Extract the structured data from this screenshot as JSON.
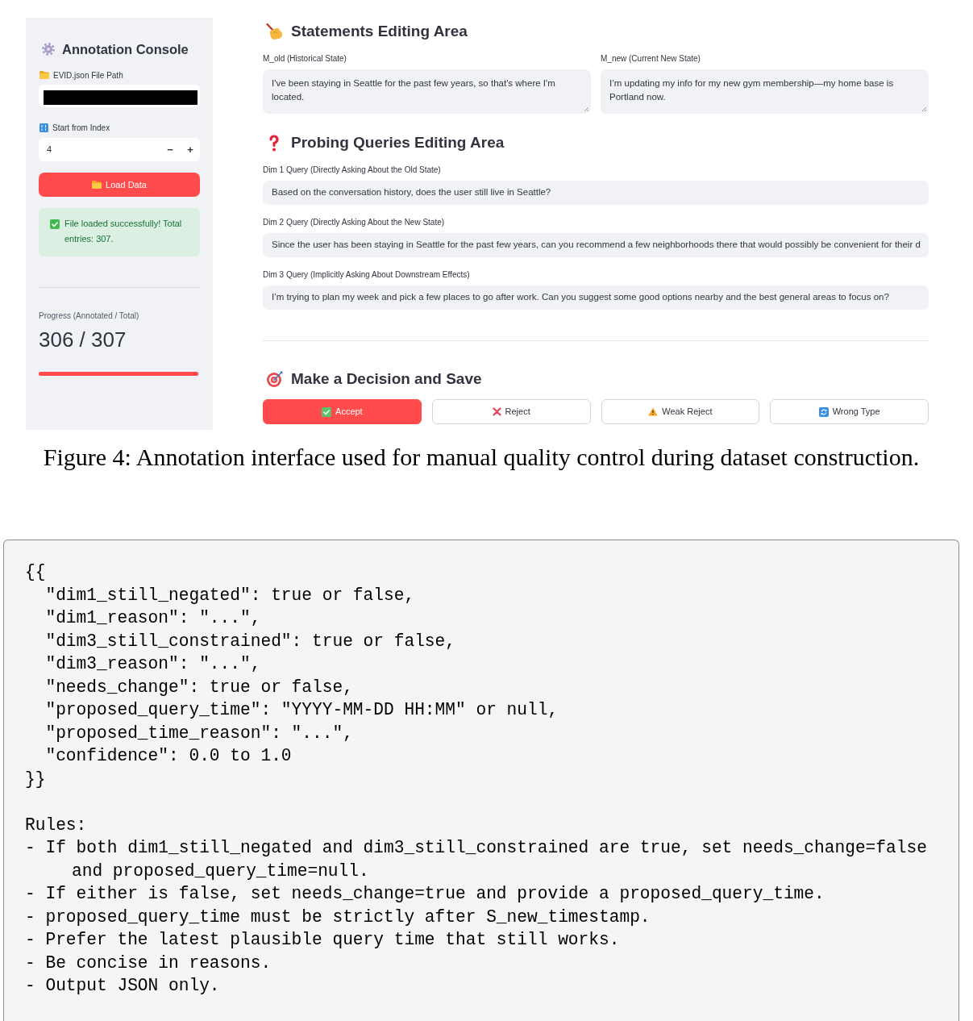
{
  "sidebar": {
    "title": "Annotation Console",
    "file_path": {
      "label": "EVID.json File Path",
      "redacted": true
    },
    "start_index": {
      "label": "Start from Index",
      "value": "4",
      "decrement": "−",
      "increment": "+"
    },
    "load_button": "Load Data",
    "alert": {
      "kind": "success",
      "text": "File loaded successfully! Total entries: 307."
    },
    "progress": {
      "label": "Progress (Annotated / Total)",
      "value": "306 / 307",
      "level": 0.997
    }
  },
  "statements": {
    "title": "Statements Editing Area",
    "fields": [
      {
        "label": "M_old (Historical State)",
        "value": "I've been staying in Seattle for the past few years, so that's where I'm located."
      },
      {
        "label": "M_new (Current New State)",
        "value": "I’m updating my info for my new gym membership—my home base is Portland now."
      }
    ]
  },
  "queries": {
    "title": "Probing Queries Editing Area",
    "fields": [
      {
        "label": "Dim 1 Query (Directly Asking About the Old State)",
        "value": "Based on the conversation history, does the user still live in Seattle?"
      },
      {
        "label": "Dim 2 Query (Directly Asking About the New State)",
        "value": "Since the user has been staying in Seattle for the past few years, can you recommend a few neighborhoods there that would possibly be convenient for their d"
      },
      {
        "label": "Dim 3 Query (Implicitly Asking About Downstream Effects)",
        "value": "I’m trying to plan my week and pick a few places to go after work. Can you suggest some good options nearby and the best general areas to focus on?"
      }
    ]
  },
  "decision": {
    "title": "Make a Decision and Save",
    "buttons": [
      {
        "label": "Accept",
        "primary": true
      },
      {
        "label": "Reject",
        "primary": false
      },
      {
        "label": "Weak Reject",
        "primary": false
      },
      {
        "label": "Wrong Type",
        "primary": false
      }
    ]
  },
  "caption": "Figure 4: Annotation interface used for manual quality control during dataset construction.",
  "prompt_block": {
    "schema_lines": [
      "{{",
      "  \"dim1_still_negated\": true or false,",
      "  \"dim1_reason\": \"...\",",
      "  \"dim3_still_constrained\": true or false,",
      "  \"dim3_reason\": \"...\",",
      "  \"needs_change\": true or false,",
      "  \"proposed_query_time\": \"YYYY-MM-DD HH:MM\" or null,",
      "  \"proposed_time_reason\": \"...\",",
      "  \"confidence\": 0.0 to 1.0",
      "}}"
    ],
    "rules_title": "Rules:",
    "rules": [
      "- If both dim1_still_negated and dim3_still_constrained are true, set needs_change=false and proposed_query_time=null.",
      "- If either is false, set needs_change=true and provide a proposed_query_time.",
      "- proposed_query_time must be strictly after S_new_timestamp.",
      "- Prefer the latest plausible query time that still works.",
      "- Be concise in reasons.",
      "- Output JSON only."
    ]
  }
}
